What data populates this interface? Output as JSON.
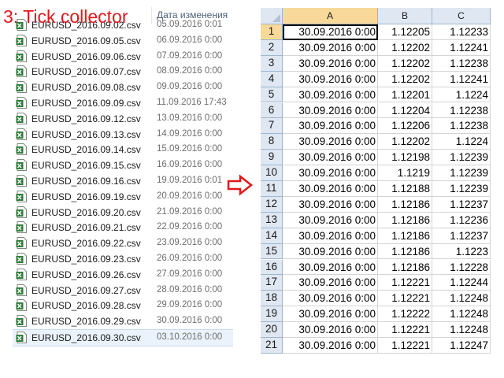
{
  "title": "3: Tick collector",
  "explorer": {
    "column_header": "Дата изменения",
    "files": [
      {
        "name": "EURUSD_2016.09.02.csv",
        "date": "05.09.2016 0:01"
      },
      {
        "name": "EURUSD_2016.09.05.csv",
        "date": "06.09.2016 0:00"
      },
      {
        "name": "EURUSD_2016.09.06.csv",
        "date": "07.09.2016 0:00"
      },
      {
        "name": "EURUSD_2016.09.07.csv",
        "date": "08.09.2016 0:00"
      },
      {
        "name": "EURUSD_2016.09.08.csv",
        "date": "09.09.2016 0:00"
      },
      {
        "name": "EURUSD_2016.09.09.csv",
        "date": "11.09.2016 17:43"
      },
      {
        "name": "EURUSD_2016.09.12.csv",
        "date": "13.09.2016 0:00"
      },
      {
        "name": "EURUSD_2016.09.13.csv",
        "date": "14.09.2016 0:00"
      },
      {
        "name": "EURUSD_2016.09.14.csv",
        "date": "15.09.2016 0:00"
      },
      {
        "name": "EURUSD_2016.09.15.csv",
        "date": "16.09.2016 0:00"
      },
      {
        "name": "EURUSD_2016.09.16.csv",
        "date": "19.09.2016 0:01"
      },
      {
        "name": "EURUSD_2016.09.19.csv",
        "date": "20.09.2016 0:00"
      },
      {
        "name": "EURUSD_2016.09.20.csv",
        "date": "21.09.2016 0:00"
      },
      {
        "name": "EURUSD_2016.09.21.csv",
        "date": "22.09.2016 0:00"
      },
      {
        "name": "EURUSD_2016.09.22.csv",
        "date": "23.09.2016 0:00"
      },
      {
        "name": "EURUSD_2016.09.23.csv",
        "date": "26.09.2016 0:00"
      },
      {
        "name": "EURUSD_2016.09.26.csv",
        "date": "27.09.2016 0:00"
      },
      {
        "name": "EURUSD_2016.09.27.csv",
        "date": "28.09.2016 0:00"
      },
      {
        "name": "EURUSD_2016.09.28.csv",
        "date": "29.09.2016 0:00"
      },
      {
        "name": "EURUSD_2016.09.29.csv",
        "date": "30.09.2016 0:00"
      },
      {
        "name": "EURUSD_2016.09.30.csv",
        "date": "03.10.2016 0:00",
        "selected": true
      }
    ],
    "icon": "excel-csv-file-icon"
  },
  "arrow_icon": "red-outline-arrow-right-icon",
  "spreadsheet": {
    "columns": [
      "A",
      "B",
      "C"
    ],
    "active_column": "A",
    "active_row": "1",
    "rows": [
      {
        "n": "1",
        "a": "30.09.2016 0:00",
        "b": "1.12205",
        "c": "1.12233"
      },
      {
        "n": "2",
        "a": "30.09.2016 0:00",
        "b": "1.12202",
        "c": "1.12241"
      },
      {
        "n": "3",
        "a": "30.09.2016 0:00",
        "b": "1.12202",
        "c": "1.12238"
      },
      {
        "n": "4",
        "a": "30.09.2016 0:00",
        "b": "1.12202",
        "c": "1.12241"
      },
      {
        "n": "5",
        "a": "30.09.2016 0:00",
        "b": "1.12201",
        "c": "1.1224"
      },
      {
        "n": "6",
        "a": "30.09.2016 0:00",
        "b": "1.12204",
        "c": "1.12238"
      },
      {
        "n": "7",
        "a": "30.09.2016 0:00",
        "b": "1.12206",
        "c": "1.12238"
      },
      {
        "n": "8",
        "a": "30.09.2016 0:00",
        "b": "1.12202",
        "c": "1.1224"
      },
      {
        "n": "9",
        "a": "30.09.2016 0:00",
        "b": "1.12198",
        "c": "1.12239"
      },
      {
        "n": "10",
        "a": "30.09.2016 0:00",
        "b": "1.1219",
        "c": "1.12239"
      },
      {
        "n": "11",
        "a": "30.09.2016 0:00",
        "b": "1.12188",
        "c": "1.12239"
      },
      {
        "n": "12",
        "a": "30.09.2016 0:00",
        "b": "1.12186",
        "c": "1.12237"
      },
      {
        "n": "13",
        "a": "30.09.2016 0:00",
        "b": "1.12186",
        "c": "1.12236"
      },
      {
        "n": "14",
        "a": "30.09.2016 0:00",
        "b": "1.12186",
        "c": "1.12237"
      },
      {
        "n": "15",
        "a": "30.09.2016 0:00",
        "b": "1.12186",
        "c": "1.1223"
      },
      {
        "n": "16",
        "a": "30.09.2016 0:00",
        "b": "1.12186",
        "c": "1.12228"
      },
      {
        "n": "17",
        "a": "30.09.2016 0:00",
        "b": "1.12221",
        "c": "1.12244"
      },
      {
        "n": "18",
        "a": "30.09.2016 0:00",
        "b": "1.12221",
        "c": "1.12248"
      },
      {
        "n": "19",
        "a": "30.09.2016 0:00",
        "b": "1.12222",
        "c": "1.12248"
      },
      {
        "n": "20",
        "a": "30.09.2016 0:00",
        "b": "1.12221",
        "c": "1.12248"
      },
      {
        "n": "21",
        "a": "30.09.2016 0:00",
        "b": "1.12221",
        "c": "1.12247"
      }
    ]
  }
}
